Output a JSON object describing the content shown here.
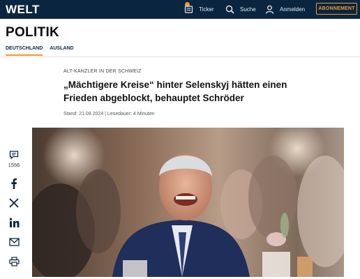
{
  "header": {
    "logo": "WELT",
    "ticker_label": "Ticker",
    "search_label": "Suche",
    "login_label": "Anmelden",
    "subscribe_label": "ABONNEMENT",
    "accent_color": "#f29a29",
    "bar_color": "#0a2540"
  },
  "section": {
    "title": "POLITIK",
    "tabs": [
      {
        "label": "DEUTSCHLAND",
        "active": true
      },
      {
        "label": "AUSLAND",
        "active": false
      }
    ]
  },
  "article": {
    "kicker": "ALT-KANZLER IN DER SCHWEIZ",
    "headline": "„Mächtigere Kreise“ hinter Selenskyj hätten einen Frieden abgeblockt, behauptet Schröder",
    "meta": "Stand: 21.09.2024 | Lesedauer: 4 Minuten",
    "image_alt": "Gerhard Schröder laughing at an event"
  },
  "share": {
    "comments_count": "1556",
    "icons": [
      "comment-icon",
      "facebook-icon",
      "x-icon",
      "linkedin-icon",
      "mail-icon",
      "print-icon"
    ]
  }
}
